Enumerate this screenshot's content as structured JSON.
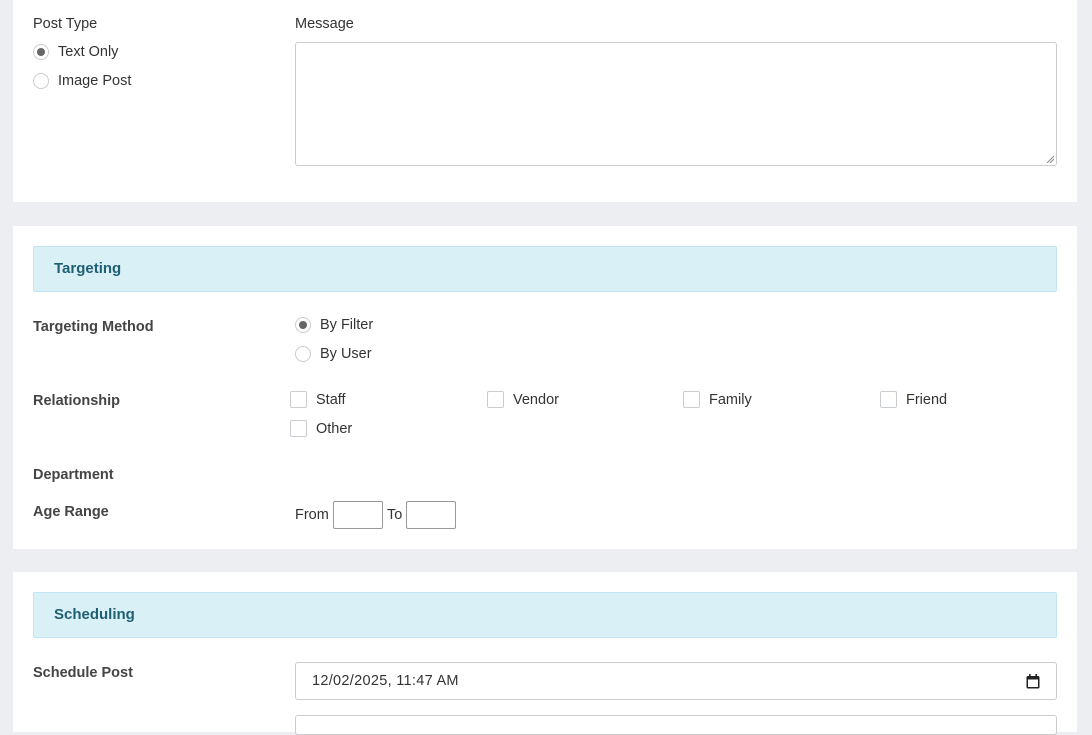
{
  "post_section": {
    "post_type_label": "Post Type",
    "options": [
      "Text Only",
      "Image Post"
    ],
    "selected": "Text Only",
    "message_label": "Message",
    "message_value": ""
  },
  "targeting": {
    "header": "Targeting",
    "method_label": "Targeting Method",
    "methods": [
      "By Filter",
      "By User"
    ],
    "selected_method": "By Filter",
    "relationship_label": "Relationship",
    "relationships": [
      "Staff",
      "Vendor",
      "Family",
      "Friend",
      "Other"
    ],
    "department_label": "Department",
    "age_range_label": "Age Range",
    "from_label": "From",
    "to_label": "To",
    "from_value": "",
    "to_value": ""
  },
  "scheduling": {
    "header": "Scheduling",
    "schedule_label": "Schedule Post",
    "schedule_value": "12/02/2025, 11:47 AM"
  },
  "colors": {
    "section_header_bg": "#d9f0f7",
    "section_header_text": "#1f5f73",
    "page_bg": "#eceef1"
  }
}
